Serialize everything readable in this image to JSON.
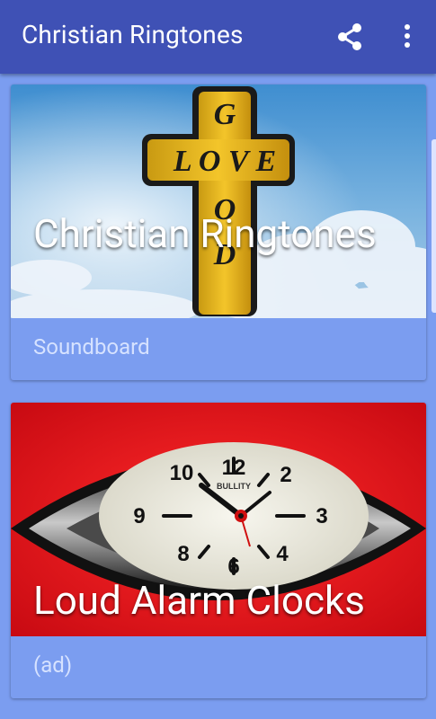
{
  "app": {
    "title": "Christian Ringtones"
  },
  "toolbar": {
    "share_icon": "share-icon",
    "more_icon": "more-vert-icon"
  },
  "cards": [
    {
      "title": "Christian Ringtones",
      "subtitle": "Soundboard",
      "image": {
        "cross_horizontal": "LOVE",
        "cross_vertical": "GOD"
      }
    },
    {
      "title": "Loud Alarm Clocks",
      "subtitle": "(ad)",
      "image": {
        "brand": "BULLITY",
        "numerals": [
          "12",
          "2",
          "3",
          "4",
          "6",
          "8",
          "9",
          "10"
        ]
      }
    }
  ],
  "colors": {
    "appbar": "#3f51b5",
    "background": "#7b9df0",
    "alarm_bg": "#e8141c"
  }
}
